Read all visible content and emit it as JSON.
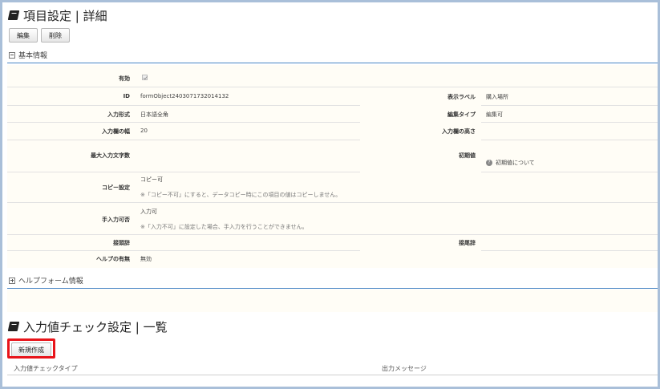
{
  "header": {
    "title": "項目設定 | 詳細",
    "edit_label": "編集",
    "delete_label": "削除"
  },
  "basic_section": {
    "title": "基本情報",
    "rows": {
      "enabled_label": "有効",
      "id_label": "ID",
      "id_value": "formObject2403071732014132",
      "display_label_label": "表示ラベル",
      "display_label_value": "購入場所",
      "input_type_label": "入力形式",
      "input_type_value": "日本語全角",
      "edit_type_label": "編集タイプ",
      "edit_type_value": "編集可",
      "input_width_label": "入力欄の幅",
      "input_width_value": "20",
      "input_height_label": "入力欄の高さ",
      "input_height_value": "",
      "max_chars_label": "最大入力文字数",
      "max_chars_value": "",
      "initial_value_label": "初期値",
      "initial_value_help": "初期値について",
      "copy_label": "コピー設定",
      "copy_value": "コピー可",
      "copy_note": "※「コピー不可」にすると、データコピー時にこの項目の値はコピーしません。",
      "manual_label": "手入力可否",
      "manual_value": "入力可",
      "manual_note": "※「入力不可」に設定した場合、手入力を行うことができません。",
      "prefix_label": "接頭辞",
      "prefix_value": "",
      "suffix_label": "接尾辞",
      "suffix_value": "",
      "help_label": "ヘルプの有無",
      "help_value": "無効"
    }
  },
  "help_section": {
    "title": "ヘルプフォーム情報"
  },
  "check_section": {
    "title": "入力値チェック設定 | 一覧",
    "new_label": "新規作成",
    "columns": [
      "入力値チェックタイプ",
      "出力メッセージ"
    ]
  },
  "colors": {
    "accent_line": "#4a86c5",
    "highlight": "#e8141a",
    "panel_bg": "#fffdf6",
    "outer_bg": "#a9bfd9"
  },
  "icons": {
    "title": "book-icon",
    "collapse": "minus-box-icon",
    "expand": "plus-box-icon",
    "help": "question-circle-icon",
    "check": "checkmark-icon"
  }
}
